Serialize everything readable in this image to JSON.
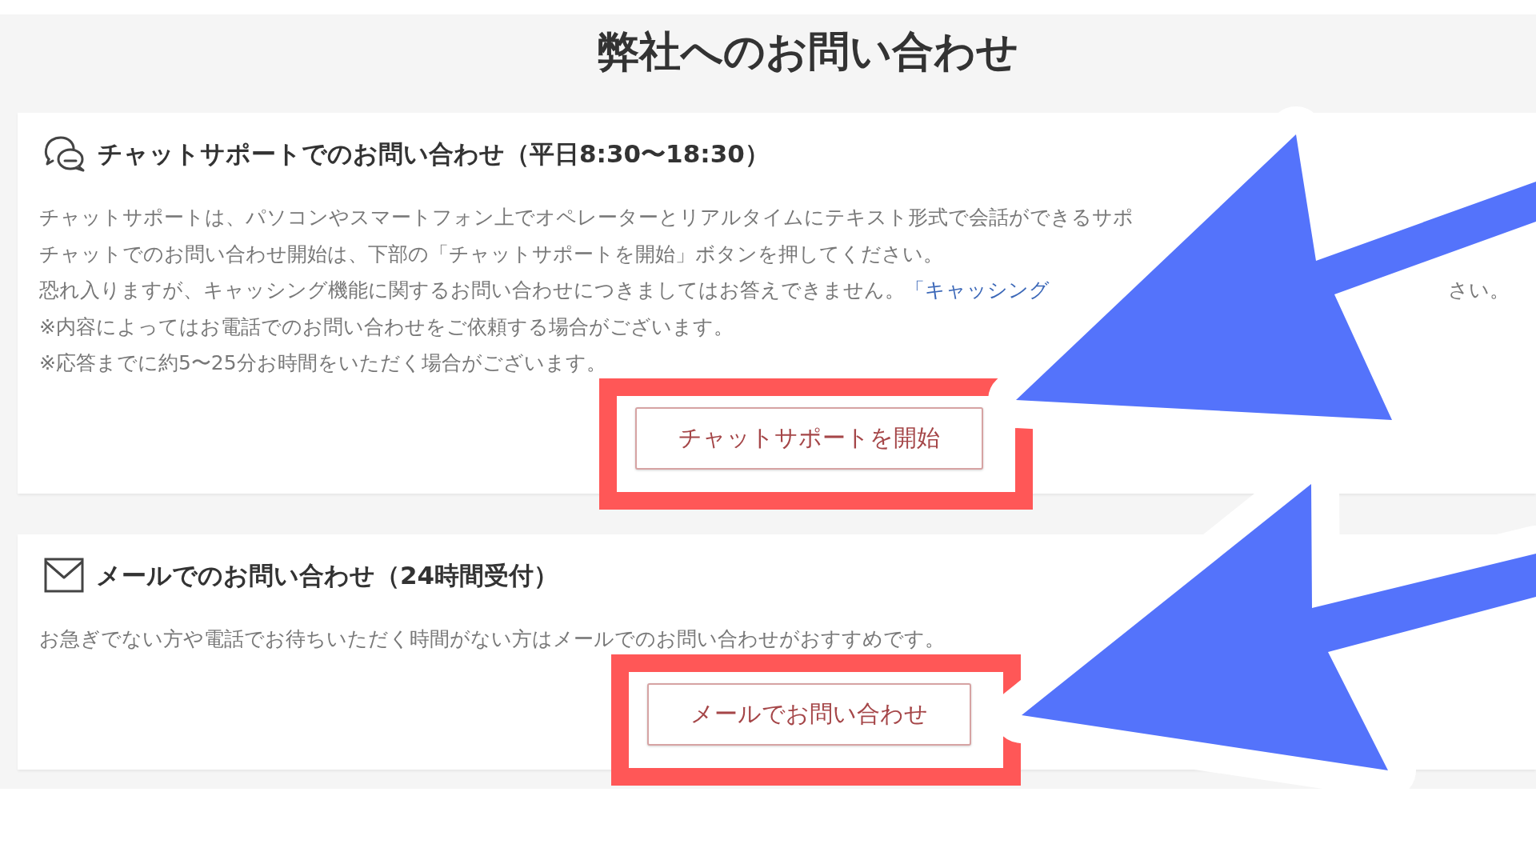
{
  "page_title": "弊社へのお問い合わせ",
  "sections": [
    {
      "kind": "chat",
      "heading": "チャットサポートでのお問い合わせ（平日8:30〜18:30）",
      "lines": [
        {
          "text": "チャットサポートは、パソコンやスマートフォン上でオペレーターとリアルタイムにテキスト形式で会話ができるサポ"
        },
        {
          "text": "チャットでのお問い合わせ開始は、下部の「チャットサポートを開始」ボタンを押してください。"
        },
        {
          "text": "恐れ入りますが、キャッシング機能に関するお問い合わせにつきましてはお答えできません。",
          "link": "「キャッシング",
          "trailing_fragment": "さい。"
        },
        {
          "text": "※内容によってはお電話でのお問い合わせをご依頼する場合がございます。"
        },
        {
          "text": "※応答までに約5〜25分お時間をいただく場合がございます。"
        }
      ],
      "button": {
        "label": "チャットサポートを開始",
        "highlight_frame": true,
        "pointer_arrow": true
      }
    },
    {
      "kind": "mail",
      "heading": "メールでのお問い合わせ（24時間受付）",
      "lines": [
        {
          "text": "お急ぎでない方や電話でお待ちいただく時間がない方はメールでのお問い合わせがおすすめです。"
        }
      ],
      "button": {
        "label": "メールでお問い合わせ",
        "highlight_frame": true,
        "pointer_arrow": true
      }
    }
  ]
}
